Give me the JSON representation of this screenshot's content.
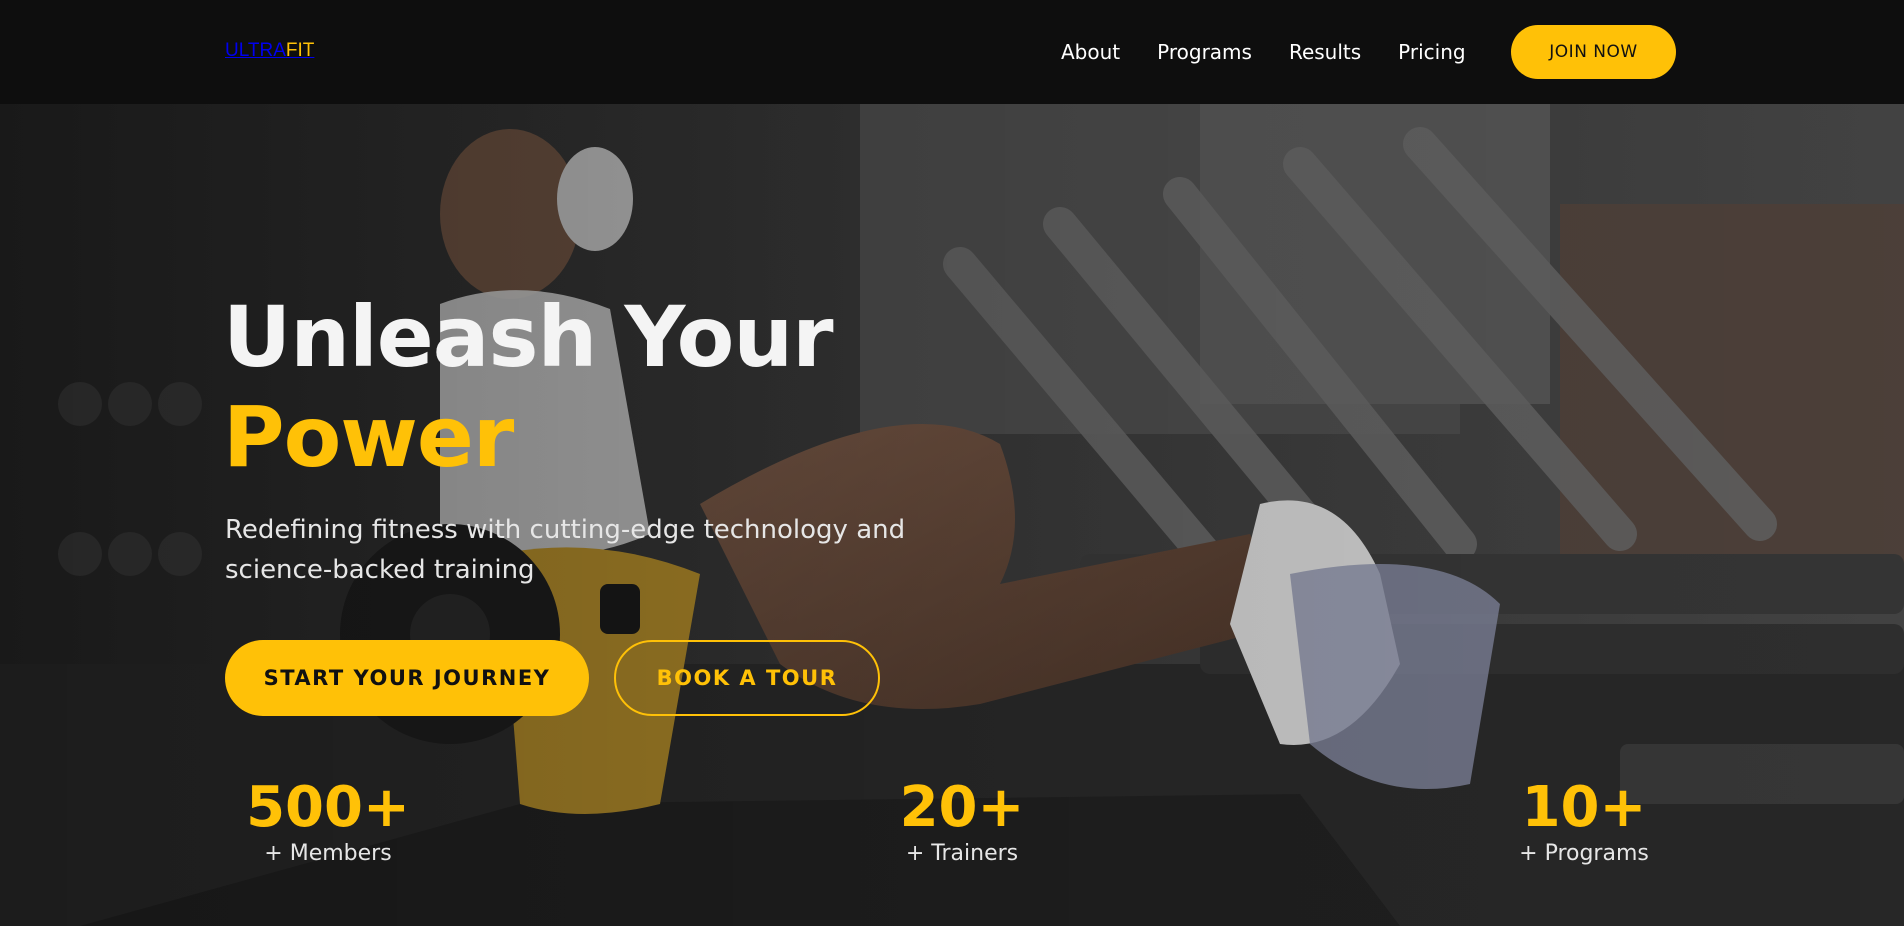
{
  "header": {
    "logo_part1": "ULTRA",
    "logo_part2": "FIT",
    "nav": [
      {
        "label": "About"
      },
      {
        "label": "Programs"
      },
      {
        "label": "Results"
      },
      {
        "label": "Pricing"
      }
    ],
    "join_label": "JOIN NOW"
  },
  "hero": {
    "headline_line1": "Unleash Your",
    "headline_line2": "Power",
    "tagline": "Redefining fitness with cutting-edge technology and science-backed training",
    "cta_primary": "START YOUR JOURNEY",
    "cta_secondary": "BOOK A TOUR",
    "stats": [
      {
        "value": "500+",
        "label": "+ Members"
      },
      {
        "value": "20+",
        "label": "+ Trainers"
      },
      {
        "value": "10+",
        "label": "+ Programs"
      }
    ]
  },
  "colors": {
    "accent": "#ffc107",
    "header_bg": "#0e0e0e",
    "text_light": "#f4f4f4"
  }
}
